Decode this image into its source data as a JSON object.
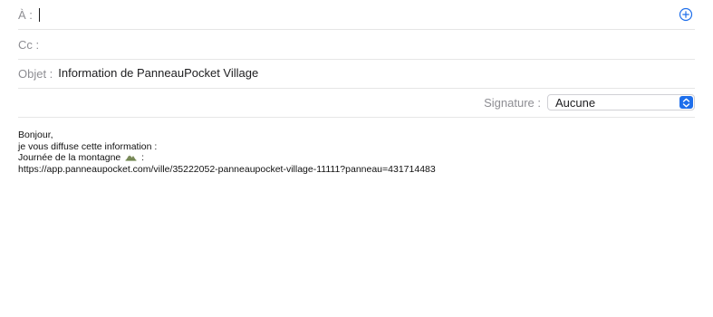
{
  "to": {
    "label": "À :",
    "value": ""
  },
  "cc": {
    "label": "Cc :",
    "value": ""
  },
  "subject": {
    "label": "Objet :",
    "value": "Information de PanneauPocket Village"
  },
  "signature": {
    "label": "Signature :",
    "selected": "Aucune"
  },
  "body": {
    "line1": "Bonjour,",
    "line2": "je vous diffuse cette information :",
    "line3_before_icon": "Journée de la montagne",
    "line3_after_icon": " :",
    "line4": "https://app.panneaupocket.com/ville/35222052-panneaupocket-village-11111?panneau=431714483"
  },
  "icons": {
    "add_contact": "plus-circle-icon",
    "stepper": "up-down-chevron-icon",
    "emoji": "mountain-icon"
  },
  "colors": {
    "accent": "#1f6feb",
    "label_gray": "#8e8e93",
    "divider": "#e6e6e6"
  }
}
